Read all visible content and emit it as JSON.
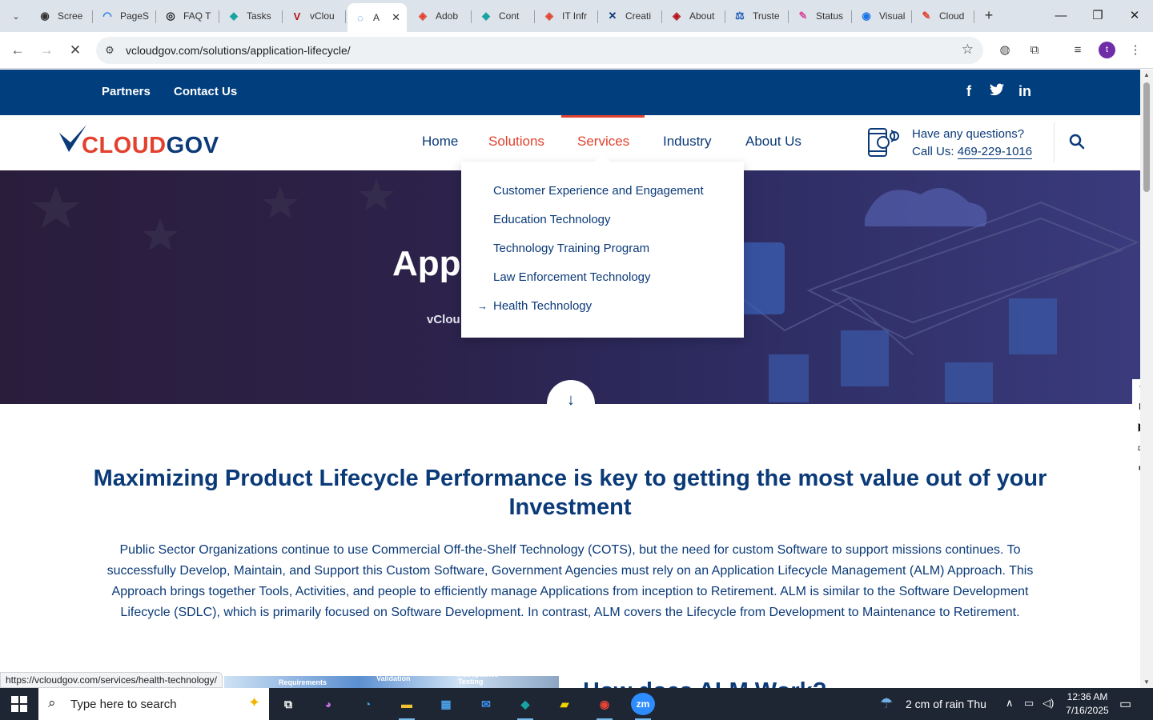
{
  "browser": {
    "tabs": [
      {
        "label": "Scree",
        "color": "#333333",
        "glyph": "◉"
      },
      {
        "label": "PageS",
        "color": "#1a73e8",
        "glyph": "◠"
      },
      {
        "label": "FAQ T",
        "color": "#202124",
        "glyph": "◎"
      },
      {
        "label": "Tasks",
        "color": "#1aa3a3",
        "glyph": "◆"
      },
      {
        "label": "vClou",
        "color": "#b5121b",
        "glyph": "V"
      },
      {
        "label": "A",
        "color": "#1a73e8",
        "glyph": "◌"
      },
      {
        "label": "Adob",
        "color": "#e2412e",
        "glyph": "◈"
      },
      {
        "label": "Cont",
        "color": "#1aa3a3",
        "glyph": "◆"
      },
      {
        "label": "IT Infr",
        "color": "#e2412e",
        "glyph": "◈"
      },
      {
        "label": "Creati",
        "color": "#0b3a78",
        "glyph": "✕"
      },
      {
        "label": "About",
        "color": "#b5121b",
        "glyph": "◈"
      },
      {
        "label": "Truste",
        "color": "#1a5ab8",
        "glyph": "⚖"
      },
      {
        "label": "Status",
        "color": "#d64fa0",
        "glyph": "✎"
      },
      {
        "label": "Visual",
        "color": "#1a73e8",
        "glyph": "◉"
      },
      {
        "label": "Cloud",
        "color": "#e2412e",
        "glyph": "✎"
      }
    ],
    "url": "vcloudgov.com/solutions/application-lifecycle/",
    "profile_initial": "t",
    "status_url": "https://vcloudgov.com/services/health-technology/"
  },
  "site": {
    "top_links": {
      "partners": "Partners",
      "contact": "Contact Us"
    },
    "social": {
      "facebook": "f",
      "twitter": "🐦",
      "linkedin": "in"
    },
    "logo": {
      "part1": "CLOUD",
      "part2": "GOV"
    },
    "nav": {
      "home": "Home",
      "solutions": "Solutions",
      "services": "Services",
      "industry": "Industry",
      "about": "About Us"
    },
    "contact": {
      "line1": "Have any questions?",
      "call_prefix": "Call Us: ",
      "phone": "469-229-1016"
    },
    "dropdown": [
      "Customer Experience and Engagement",
      "Education Technology",
      "Technology Training Program",
      "Law Enforcement Technology",
      "Health Technology"
    ],
    "hero": {
      "title": "App",
      "subtitle": "vClou"
    },
    "heading": "Maximizing Product Lifecycle Performance is key to getting the most value out of your Investment",
    "paragraph": "Public Sector Organizations continue to use Commercial Off-the-Shelf Technology (COTS), but the need for custom Software to support missions continues. To successfully Develop, Maintain, and Support this Custom Software, Government Agencies must rely on an Application Lifecycle Management (ALM) Approach. This Approach brings together Tools, Activities, and people to efficiently manage Applications from inception to Retirement. ALM is similar to the Software Development Lifecycle (SDLC), which is primarily focused on Software Development. In contrast, ALM covers the Lifecycle from Development to Maintenance to Retirement.",
    "img_labels": {
      "requirements": "Requirements",
      "validation": "Validation",
      "acceptance": "Acceptance Testing"
    },
    "partial_heading": "How does ALM Work?"
  },
  "taskbar": {
    "search_placeholder": "Type here to search",
    "weather": "2 cm of rain Thu",
    "time": "12:36 AM",
    "date": "7/16/2025"
  }
}
